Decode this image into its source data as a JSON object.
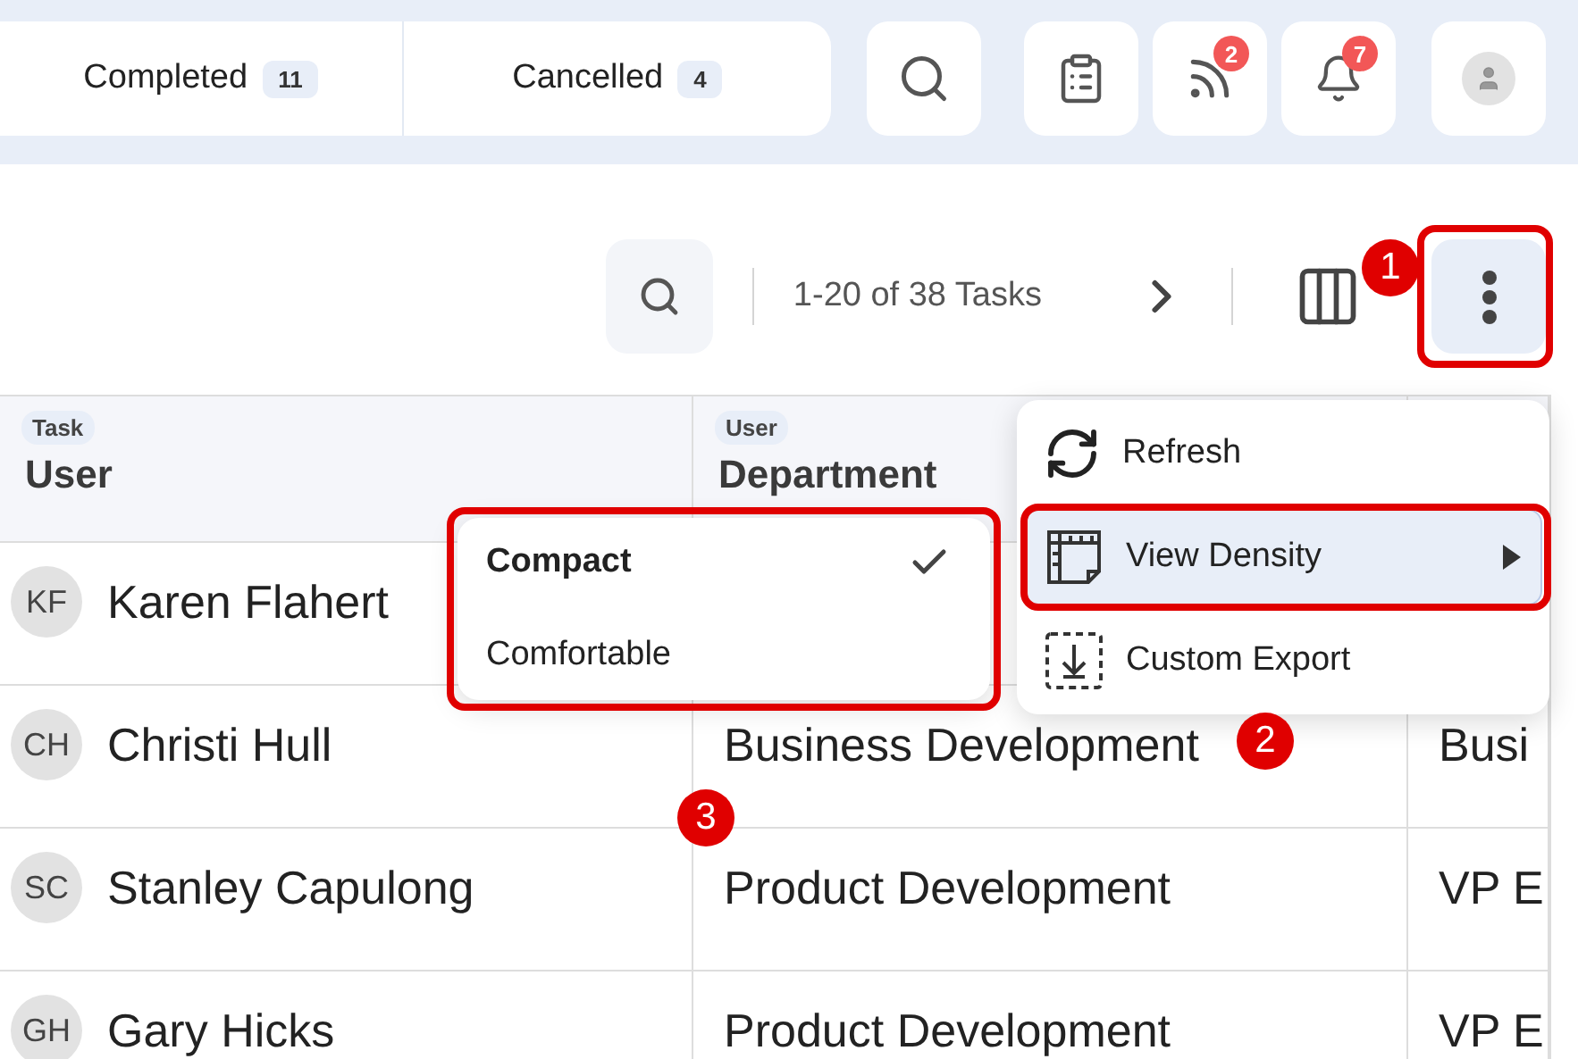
{
  "tabs": [
    {
      "label": "Completed",
      "count": "11",
      "selected": false
    },
    {
      "label": "Cancelled",
      "count": "4",
      "selected": false
    }
  ],
  "header_icons": [
    {
      "kind": "search"
    },
    {
      "kind": "clipboard"
    },
    {
      "kind": "feed",
      "badge": "2"
    },
    {
      "kind": "bell",
      "badge": "7"
    },
    {
      "kind": "avatar"
    }
  ],
  "toolbar": {
    "pagination": "1-20 of 38 Tasks"
  },
  "table": {
    "columns": [
      {
        "group": "Task",
        "label": "User"
      },
      {
        "group": "User",
        "label": "Department"
      }
    ],
    "rows": [
      {
        "initials": "KF",
        "user": "Karen Flahert"
      },
      {
        "initials": "CH",
        "user": "Christi Hull",
        "department": "Business Development",
        "column_3": "Busi"
      },
      {
        "initials": "SC",
        "user": "Stanley Capulong",
        "department": "Product Development",
        "column_3": "VP E"
      },
      {
        "initials": "GH",
        "user": "Gary Hicks",
        "department": "Product Development",
        "column_3": "VP E"
      }
    ]
  },
  "menu": {
    "items": [
      {
        "kind": "refresh",
        "label": "Refresh",
        "highlighted": false,
        "submenu": false
      },
      {
        "kind": "density",
        "label": "View Density",
        "highlighted": true,
        "submenu": true
      },
      {
        "kind": "export",
        "label": "Custom Export",
        "highlighted": false,
        "submenu": false
      }
    ]
  },
  "submenu": {
    "items": [
      {
        "label": "Compact",
        "selected": true
      },
      {
        "label": "Comfortable",
        "selected": false
      }
    ]
  },
  "annotations": [
    {
      "number": "1"
    },
    {
      "number": "2"
    },
    {
      "number": "3"
    }
  ]
}
